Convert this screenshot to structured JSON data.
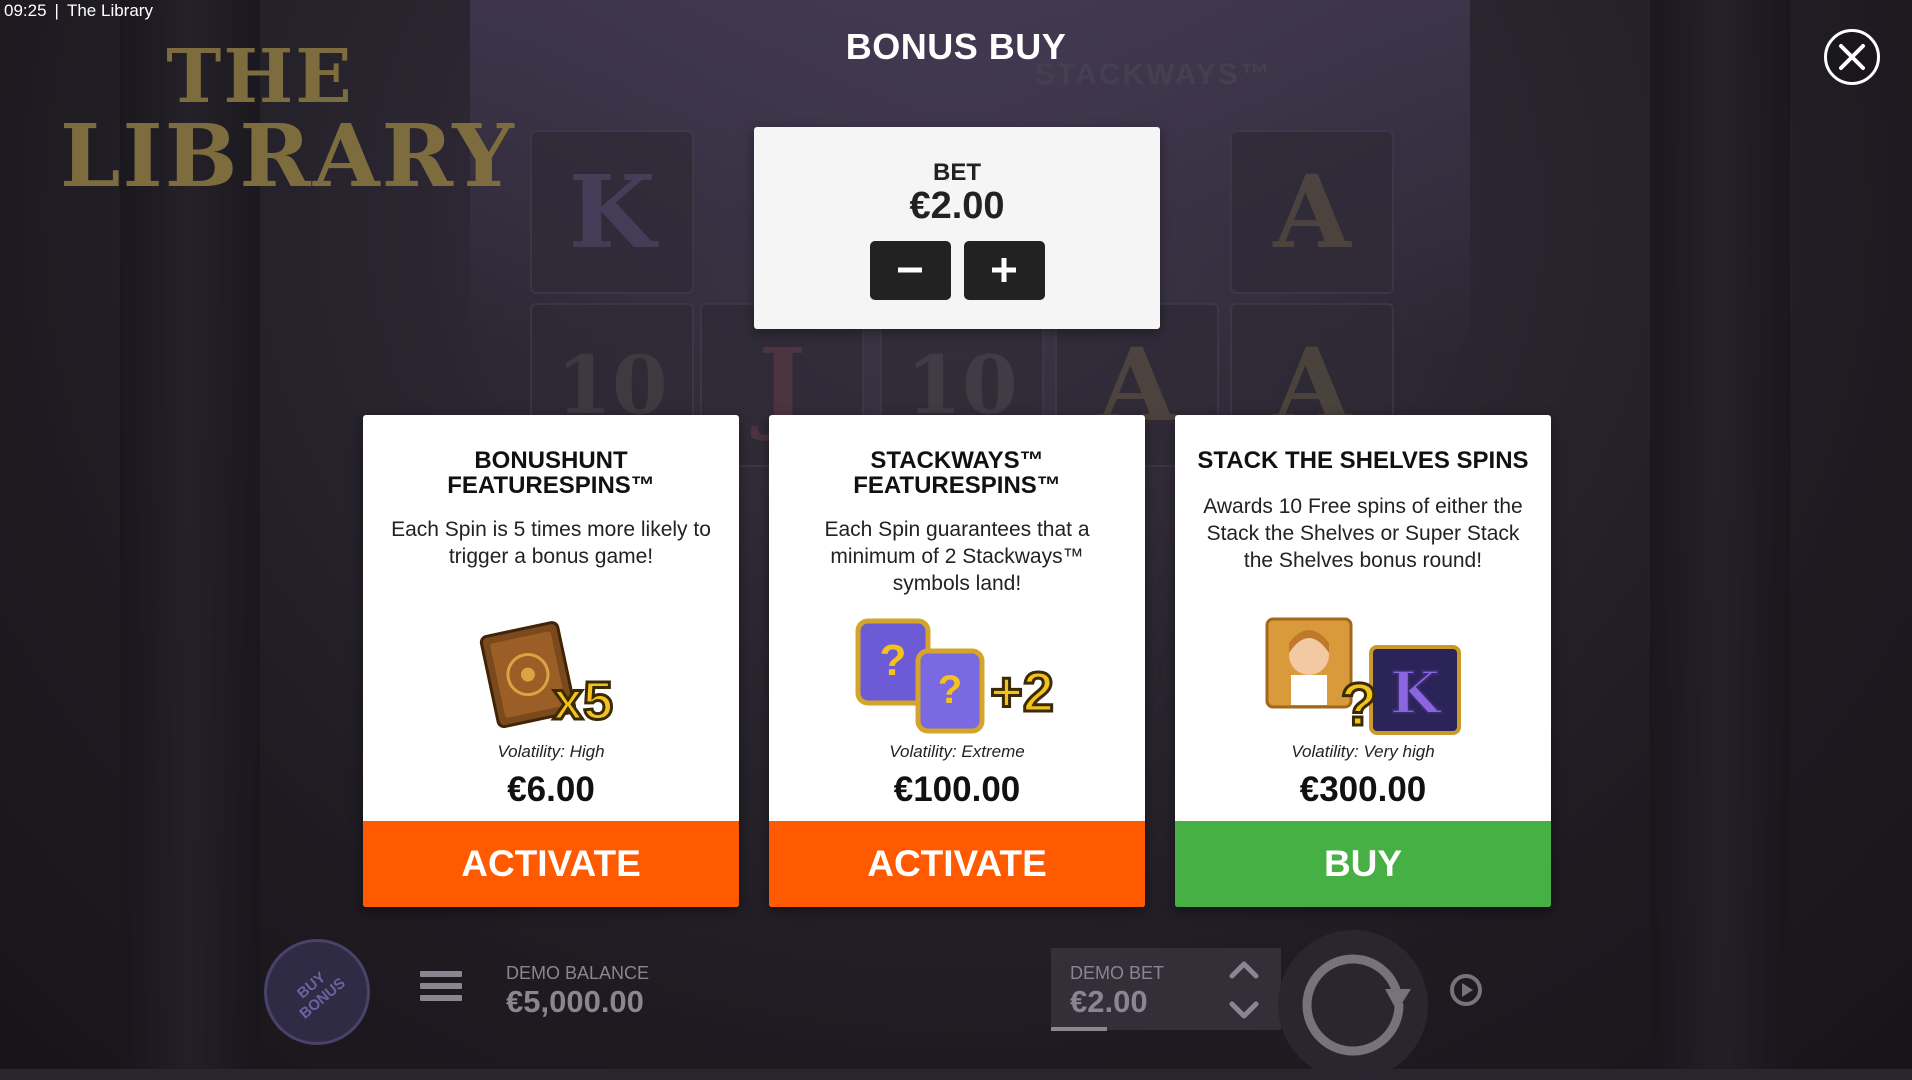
{
  "status_bar": {
    "time": "09:25",
    "app_title": "The Library"
  },
  "logo": {
    "line1": "THE",
    "line2": "LIBRARY"
  },
  "background": {
    "reel_symbols": [
      "K",
      "A",
      "10",
      "J",
      "10",
      "A",
      "A"
    ],
    "watermark": "STACKWAYS™"
  },
  "modal": {
    "title": "BONUS BUY",
    "bet": {
      "label": "BET",
      "value": "€2.00",
      "decrease_symbol": "−",
      "increase_symbol": "+"
    },
    "cards": [
      {
        "title_line1": "BONUSHUNT",
        "title_line2": "FEATURESPINS™",
        "description": "Each Spin is 5 times more likely to trigger a bonus game!",
        "volatility": "Volatility: High",
        "price": "€6.00",
        "button": "ACTIVATE",
        "button_color": "#ff5a00",
        "art_label": "x5"
      },
      {
        "title_line1": "STACKWAYS™",
        "title_line2": "FEATURESPINS™",
        "description": "Each Spin guarantees that a minimum of 2 Stackways™ symbols land!",
        "volatility": "Volatility: Extreme",
        "price": "€100.00",
        "button": "ACTIVATE",
        "button_color": "#ff5a00",
        "art_label": "+2"
      },
      {
        "title_line1": "STACK THE SHELVES SPINS",
        "title_line2": "",
        "description": "Awards 10 Free spins of either the Stack the Shelves or Super Stack the Shelves bonus round!",
        "volatility": "Volatility: Very high",
        "price": "€300.00",
        "button": "BUY",
        "button_color": "#46b044",
        "art_label": "K"
      }
    ]
  },
  "bottom_bar": {
    "buy_bonus_line1": "BUY",
    "buy_bonus_line2": "BONUS",
    "balance_label": "DEMO BALANCE",
    "balance_value": "€5,000.00",
    "bet_label": "DEMO BET",
    "bet_value": "€2.00"
  },
  "colors": {
    "accent_orange": "#ff5a00",
    "accent_green": "#46b044",
    "panel": "#f5f5f5"
  }
}
